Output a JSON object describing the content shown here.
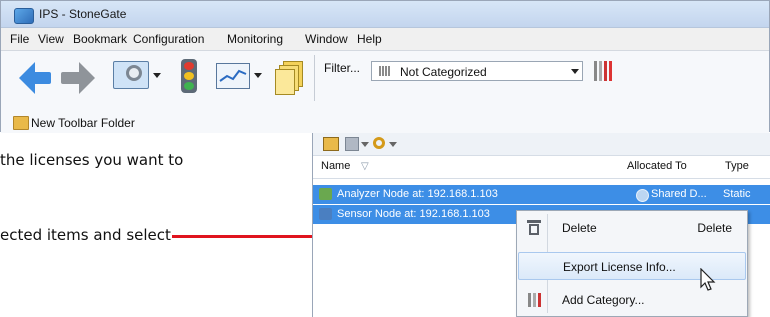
{
  "app": {
    "title": "IPS - StoneGate"
  },
  "menu": [
    "File",
    "View",
    "Bookmark",
    "Configuration",
    "Monitoring",
    "Window",
    "Help"
  ],
  "toolbar": {
    "filter_label": "Filter...",
    "filter_value": "Not Categorized",
    "folder_label": "New Toolbar Folder"
  },
  "instructions": {
    "line1": "the licenses you want to",
    "line2": "ected items and select"
  },
  "panel": {
    "columns": {
      "name": "Name",
      "allocated": "Allocated To",
      "type": "Type"
    },
    "rows": [
      {
        "name": "Analyzer Node at: 192.168.1.103",
        "allocated": "Shared D...",
        "type": "Static"
      },
      {
        "name": "Sensor Node at: 192.168.1.103",
        "allocated": "",
        "type": ""
      }
    ]
  },
  "context_menu": {
    "delete_label": "Delete",
    "delete_shortcut": "Delete",
    "export_label": "Export License Info...",
    "add_category_label": "Add Category..."
  },
  "colors": {
    "accent": "#3d8ee6",
    "callout": "#e0141e",
    "menu_highlight": "#dbe9f9"
  }
}
